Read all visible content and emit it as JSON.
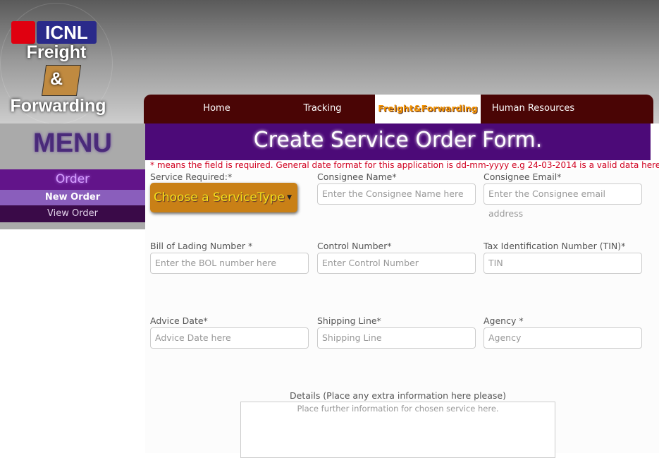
{
  "logo": {
    "brand": "ICNL",
    "line1": "Freight",
    "line2": "&",
    "line3": "Forwarding"
  },
  "nav": [
    {
      "label": "Home"
    },
    {
      "label": "Tracking"
    },
    {
      "label": "Freight&Forwarding"
    },
    {
      "label": "Human Resources"
    }
  ],
  "sidebar": {
    "title": "MENU",
    "section": "Order",
    "items": [
      {
        "label": "New Order"
      },
      {
        "label": "View Order"
      }
    ]
  },
  "form": {
    "title": "Create Service Order Form.",
    "note": "* means the field is required. General date format for this application is dd-mm-yyyy e.g 24-03-2014 is a valid data here.",
    "service": {
      "label": "Service Required:*",
      "value": "Choose a ServiceType"
    },
    "fields": [
      {
        "label": "Consignee Name*",
        "placeholder": "Enter the Consignee Name here"
      },
      {
        "label": "Consignee Email*",
        "placeholder": "Enter the Consignee email address"
      },
      {
        "label": "Bill of Lading Number *",
        "placeholder": "Enter the BOL number here"
      },
      {
        "label": "Control Number*",
        "placeholder": "Enter Control Number"
      },
      {
        "label": "Tax Identification Number (TIN)*",
        "placeholder": "TIN"
      },
      {
        "label": "Advice Date*",
        "placeholder": "Advice Date here"
      },
      {
        "label": "Shipping Line*",
        "placeholder": "Shipping Line"
      },
      {
        "label": "Agency *",
        "placeholder": "Agency"
      }
    ],
    "details": {
      "label": "Details (Place any extra information here please)",
      "placeholder": "Place further information for chosen service here."
    }
  }
}
